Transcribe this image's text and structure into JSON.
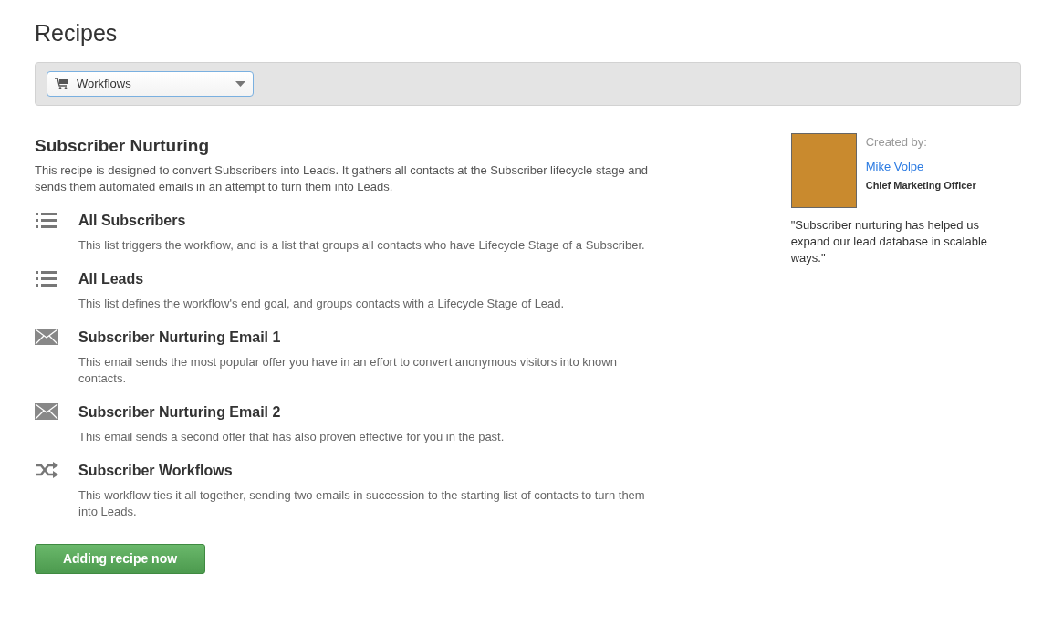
{
  "page_title": "Recipes",
  "filter": {
    "value": "Workflows"
  },
  "recipe": {
    "title": "Subscriber Nurturing",
    "description": "This recipe is designed to convert Subscribers into Leads. It gathers all contacts at the Subscriber lifecycle stage and sends them automated emails in an attempt to turn them into Leads.",
    "items": [
      {
        "kind": "list",
        "title": "All Subscribers",
        "description": "This list triggers the workflow, and is a list that groups all contacts who have Lifecycle Stage of a Subscriber."
      },
      {
        "kind": "list",
        "title": "All Leads",
        "description": "This list defines the workflow's end goal, and groups contacts with a Lifecycle Stage of Lead."
      },
      {
        "kind": "email",
        "title": "Subscriber Nurturing Email 1",
        "description": "This email sends the most popular offer you have in an effort to convert anonymous visitors into known contacts."
      },
      {
        "kind": "email",
        "title": "Subscriber Nurturing Email 2",
        "description": "This email sends a second offer that has also proven effective for you in the past."
      },
      {
        "kind": "workflow",
        "title": "Subscriber Workflows",
        "description": "This workflow ties it all together, sending two emails in succession to the starting list of contacts to turn them into Leads."
      }
    ],
    "button": "Adding recipe now"
  },
  "author": {
    "label": "Created by:",
    "name": "Mike Volpe",
    "role": "Chief Marketing Officer",
    "quote": "\"Subscriber nurturing has helped us expand our lead database in scalable ways.\""
  }
}
